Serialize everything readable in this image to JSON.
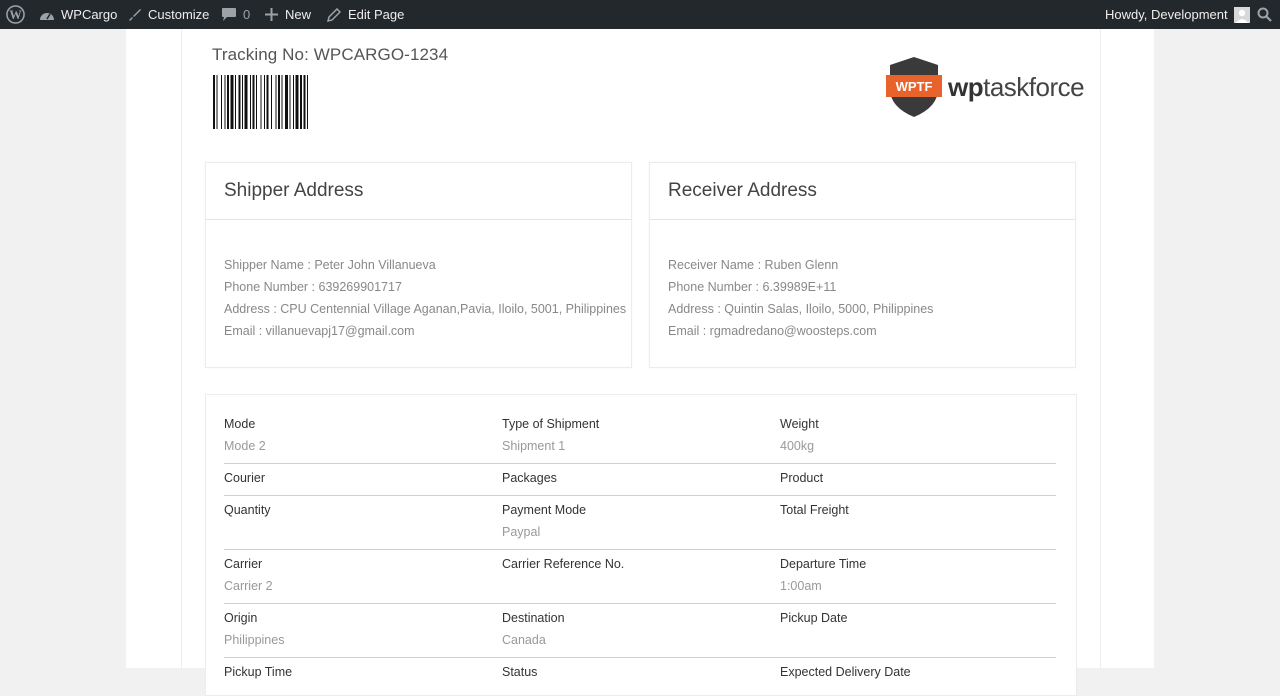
{
  "admin_bar": {
    "site_name": "WPCargo",
    "customize": "Customize",
    "comments_count": "0",
    "new": "New",
    "edit_page": "Edit Page",
    "howdy": "Howdy, Development"
  },
  "tracking": {
    "title": "Tracking No: WPCARGO-1234"
  },
  "logo": {
    "badge": "WPTF",
    "text_bold": "wp",
    "text_rest": "taskforce"
  },
  "shipper": {
    "heading": "Shipper Address",
    "lines": [
      "Shipper Name : Peter John Villanueva",
      "Phone Number : 639269901717",
      "Address : CPU Centennial Village Aganan,Pavia, Iloilo, 5001, Philippines",
      "Email : villanuevapj17@gmail.com"
    ]
  },
  "receiver": {
    "heading": "Receiver Address",
    "lines": [
      "Receiver Name : Ruben Glenn",
      "Phone Number : 6.39989E+11",
      "Address : Quintin Salas, Iloilo, 5000, Philippines",
      "Email : rgmadredano@woosteps.com"
    ]
  },
  "details": {
    "rows": [
      [
        {
          "label": "Mode",
          "value": "Mode 2"
        },
        {
          "label": "Type of Shipment",
          "value": "Shipment 1"
        },
        {
          "label": "Weight",
          "value": "400kg"
        }
      ],
      [
        {
          "label": "Courier",
          "value": ""
        },
        {
          "label": "Packages",
          "value": ""
        },
        {
          "label": "Product",
          "value": ""
        }
      ],
      [
        {
          "label": "Quantity",
          "value": ""
        },
        {
          "label": "Payment Mode",
          "value": "Paypal"
        },
        {
          "label": "Total Freight",
          "value": ""
        }
      ],
      [
        {
          "label": "Carrier",
          "value": "Carrier 2"
        },
        {
          "label": "Carrier Reference No.",
          "value": ""
        },
        {
          "label": "Departure Time",
          "value": "1:00am"
        }
      ],
      [
        {
          "label": "Origin",
          "value": "Philippines"
        },
        {
          "label": "Destination",
          "value": "Canada"
        },
        {
          "label": "Pickup Date",
          "value": ""
        }
      ],
      [
        {
          "label": "Pickup Time",
          "value": ""
        },
        {
          "label": "Status",
          "value": ""
        },
        {
          "label": "Expected Delivery Date",
          "value": ""
        }
      ]
    ]
  },
  "colors": {
    "admin_bar_bg": "#23282d",
    "logo_orange": "#e8622c",
    "logo_dark": "#3a3a3a"
  }
}
